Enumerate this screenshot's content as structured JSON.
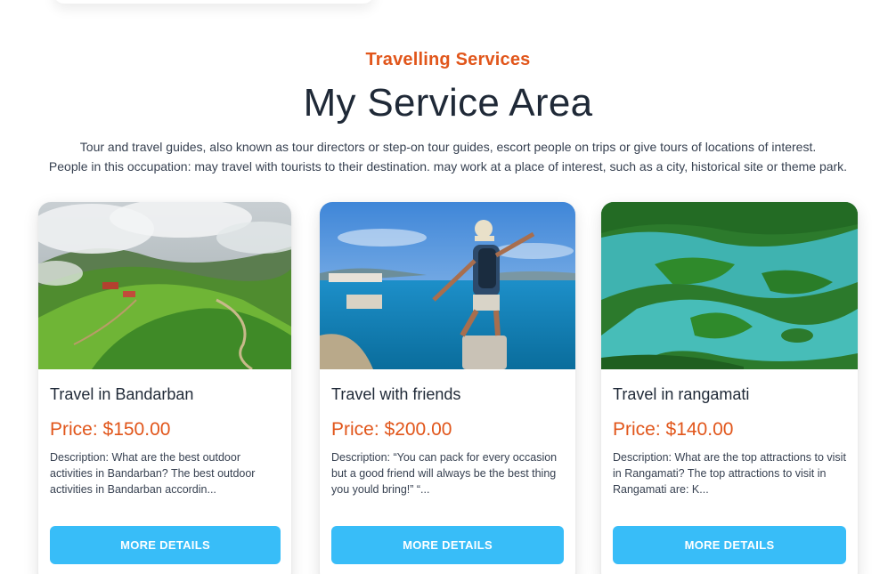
{
  "header": {
    "eyebrow": "Travelling Services",
    "title": "My Service Area",
    "description_line1": "Tour and travel guides, also known as tour directors or step-on tour guides, escort people on trips or give tours of locations of interest.",
    "description_line2": "People in this occupation: may travel with tourists to their destination. may work at a place of interest, such as a city, historical site or theme park."
  },
  "cards": [
    {
      "title": "Travel in Bandarban",
      "price": "Price: $150.00",
      "description": "Description: What are the best outdoor activities in Bandarban? The best outdoor activities in Bandarban accordin...",
      "button": "MORE DETAILS"
    },
    {
      "title": "Travel with friends",
      "price": "Price: $200.00",
      "description": "Description: “You can pack for every occasion but a good friend will always be the best thing you yould bring!” “...",
      "button": "MORE DETAILS"
    },
    {
      "title": "Travel in rangamati",
      "price": "Price: $140.00",
      "description": "Description: What are the top attractions to visit in Rangamati? The top attractions to visit in Rangamati are: K...",
      "button": "MORE DETAILS"
    }
  ],
  "colors": {
    "accent": "#e1561b",
    "button": "#38bdf8",
    "text": "#1f2937"
  }
}
